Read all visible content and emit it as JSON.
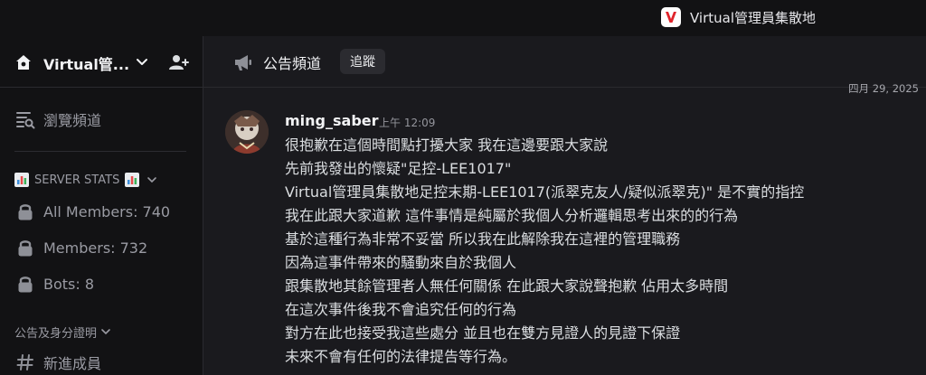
{
  "window": {
    "title": "Virtual管理員集散地",
    "logo_letter": "V",
    "logo_color": "#e0242b"
  },
  "sidebar": {
    "server_name": "Virtual管...",
    "browse_channels": "瀏覽頻道",
    "stats_category": "SERVER STATS",
    "stats": [
      {
        "label": "All Members: 740",
        "icon": "lock-icon"
      },
      {
        "label": "Members: 732",
        "icon": "lock-icon"
      },
      {
        "label": "Bots: 8",
        "icon": "lock-icon"
      }
    ],
    "announce_category": "公告及身分證明",
    "channels": [
      {
        "label": "新進成員",
        "icon": "hash-icon"
      }
    ]
  },
  "channel": {
    "name": "公告頻道",
    "follow_label": "追蹤"
  },
  "date_separator": "四月 29, 2025",
  "message": {
    "author": "ming_saber",
    "time": "上午 12:09",
    "lines": [
      "很抱歉在這個時間點打擾大家 我在這邊要跟大家說",
      "先前我發出的懷疑\"足控-LEE1017\"",
      "Virtual管理員集散地足控末期-LEE1017(派翠克友人/疑似派翠克)\" 是不實的指控",
      "我在此跟大家道歉 這件事情是純屬於我個人分析邏輯思考出來的的行為",
      "基於這種行為非常不妥當 所以我在此解除我在這裡的管理職務",
      "因為這事件帶來的騷動來自於我個人",
      "跟集散地其餘管理者人無任何關係 在此跟大家說聲抱歉 佔用太多時間",
      "在這次事件後我不會追究任何的行為",
      "對方在此也接受我這些處分 並且也在雙方見證人的見證下保證",
      "未來不會有任何的法律提告等行為。"
    ]
  }
}
